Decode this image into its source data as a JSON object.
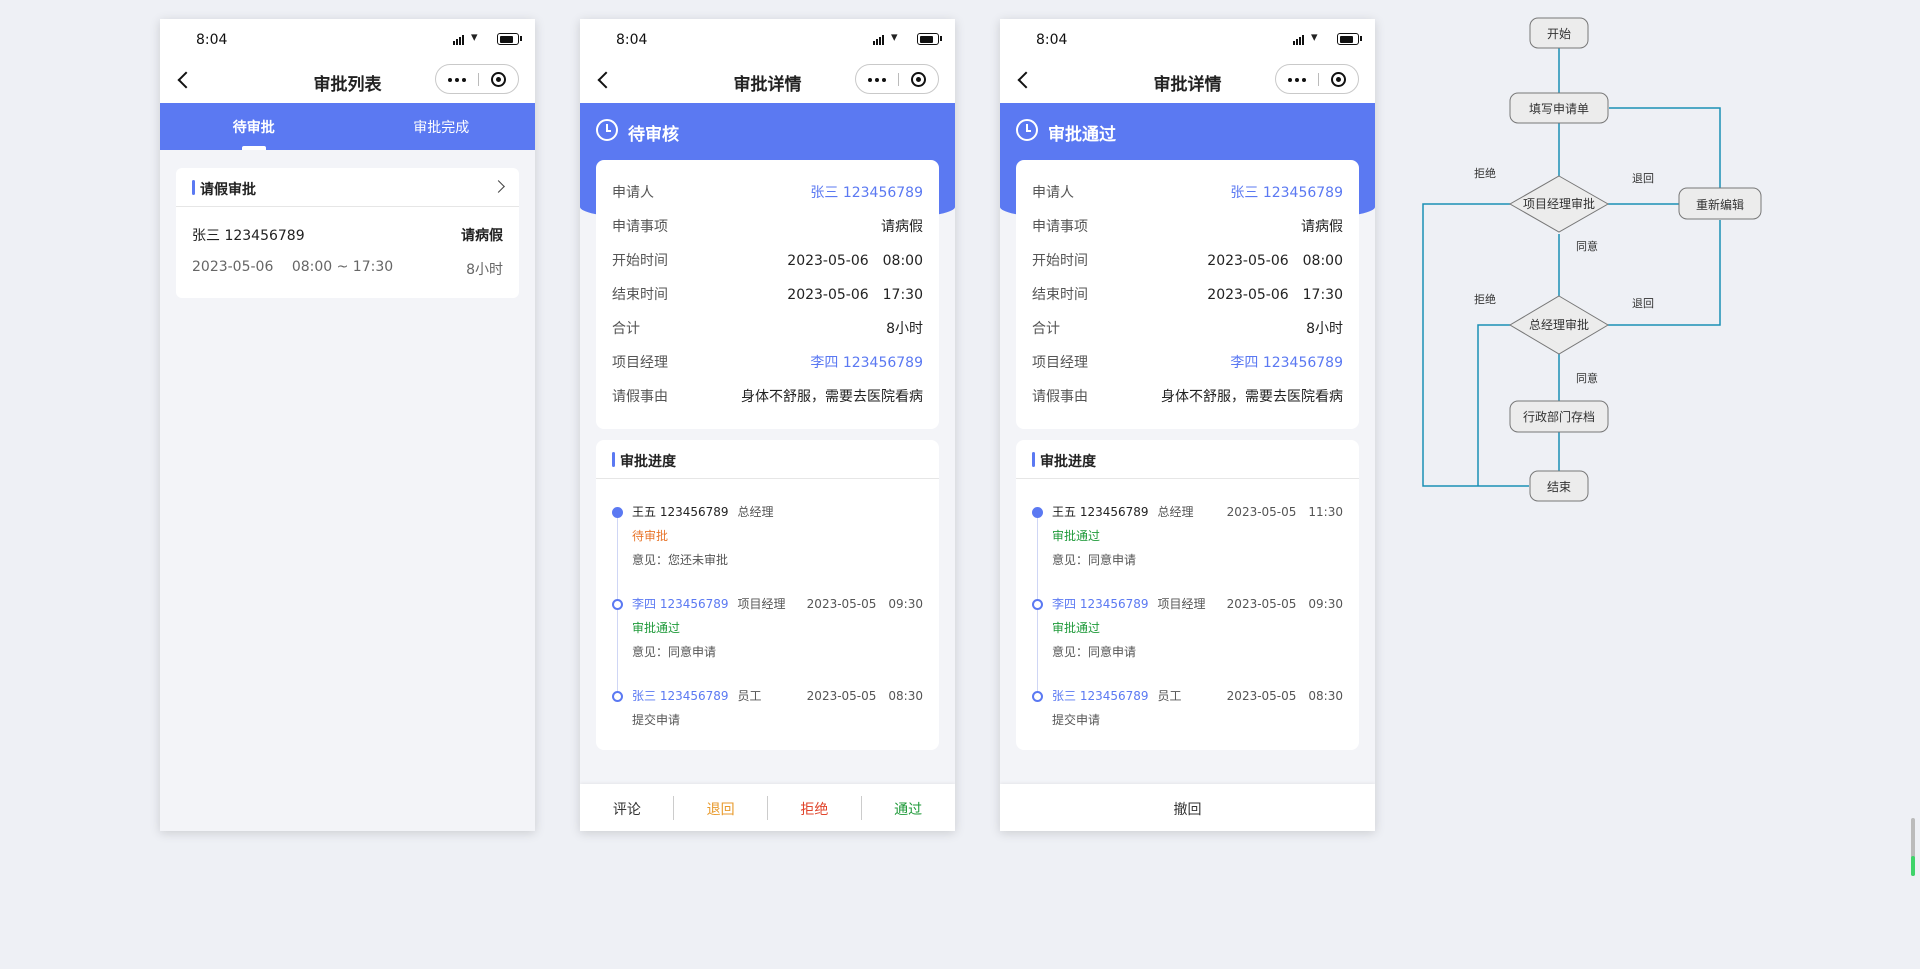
{
  "colors": {
    "accent": "#5b79f2",
    "pending": "#e8762c",
    "approved": "#1f9a3a",
    "returned": "#e89a2c",
    "rejected": "#e0442b",
    "flow_line": "#1a8fb5"
  },
  "status_bar": {
    "time": "8:04"
  },
  "list_screen": {
    "title": "审批列表",
    "tabs": [
      {
        "label": "待审批",
        "active": true
      },
      {
        "label": "审批完成",
        "active": false
      }
    ],
    "card": {
      "title": "请假审批",
      "applicant": "张三 123456789",
      "type": "请病假",
      "date": "2023-05-06",
      "time_range": "08:00 ~ 17:30",
      "duration": "8小时"
    }
  },
  "detail_pending": {
    "title": "审批详情",
    "status": "待审核",
    "fields": [
      {
        "label": "申请人",
        "value": "张三 123456789",
        "link": true
      },
      {
        "label": "申请事项",
        "value": "请病假"
      },
      {
        "label": "开始时间",
        "value": "2023-05-06　08:00"
      },
      {
        "label": "结束时间",
        "value": "2023-05-06　17:30"
      },
      {
        "label": "合计",
        "value": "8小时"
      },
      {
        "label": "项目经理",
        "value": "李四 123456789",
        "link": true
      },
      {
        "label": "请假事由",
        "value": "身体不舒服，需要去医院看病"
      }
    ],
    "progress_title": "审批进度",
    "timeline": [
      {
        "name": "王五 123456789",
        "role": "总经理",
        "time": "",
        "status": "待审批",
        "status_kind": "pending",
        "note": "意见：您还未审批",
        "link": false,
        "filled": true
      },
      {
        "name": "李四 123456789",
        "role": "项目经理",
        "time": "2023-05-05　09:30",
        "status": "审批通过",
        "status_kind": "approved",
        "note": "意见：同意申请",
        "link": true,
        "filled": false
      },
      {
        "name": "张三 123456789",
        "role": "员工",
        "time": "2023-05-05　08:30",
        "sub": "提交申请",
        "link": true,
        "filled": false
      }
    ],
    "actions": [
      {
        "label": "评论",
        "kind": "comment"
      },
      {
        "label": "退回",
        "kind": "return"
      },
      {
        "label": "拒绝",
        "kind": "reject"
      },
      {
        "label": "通过",
        "kind": "approve"
      }
    ]
  },
  "detail_approved": {
    "title": "审批详情",
    "status": "审批通过",
    "fields": [
      {
        "label": "申请人",
        "value": "张三 123456789",
        "link": true
      },
      {
        "label": "申请事项",
        "value": "请病假"
      },
      {
        "label": "开始时间",
        "value": "2023-05-06　08:00"
      },
      {
        "label": "结束时间",
        "value": "2023-05-06　17:30"
      },
      {
        "label": "合计",
        "value": "8小时"
      },
      {
        "label": "项目经理",
        "value": "李四 123456789",
        "link": true
      },
      {
        "label": "请假事由",
        "value": "身体不舒服，需要去医院看病"
      }
    ],
    "progress_title": "审批进度",
    "timeline": [
      {
        "name": "王五 123456789",
        "role": "总经理",
        "time": "2023-05-05　11:30",
        "status": "审批通过",
        "status_kind": "approved",
        "note": "意见：同意申请",
        "link": false,
        "filled": true
      },
      {
        "name": "李四 123456789",
        "role": "项目经理",
        "time": "2023-05-05　09:30",
        "status": "审批通过",
        "status_kind": "approved",
        "note": "意见：同意申请",
        "link": true,
        "filled": false
      },
      {
        "name": "张三 123456789",
        "role": "员工",
        "time": "2023-05-05　08:30",
        "sub": "提交申请",
        "link": true,
        "filled": false
      }
    ],
    "actions": [
      {
        "label": "撤回",
        "kind": "withdraw"
      }
    ]
  },
  "flowchart": {
    "nodes": {
      "start": "开始",
      "fill_form": "填写申请单",
      "pm_approve": "项目经理审批",
      "re_edit": "重新编辑",
      "gm_approve": "总经理审批",
      "admin_archive": "行政部门存档",
      "end": "结束"
    },
    "edge_labels": {
      "pm_reject": "拒绝",
      "pm_return": "退回",
      "pm_agree": "同意",
      "gm_reject": "拒绝",
      "gm_return": "退回",
      "gm_agree": "同意"
    }
  }
}
